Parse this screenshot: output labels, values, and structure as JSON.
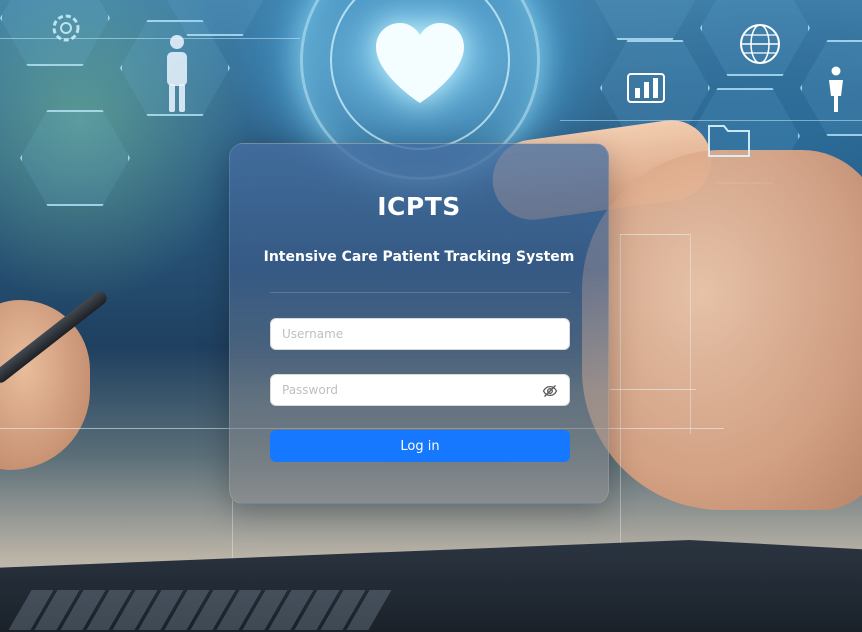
{
  "app": {
    "title": "ICPTS",
    "subtitle": "Intensive Care Patient Tracking System"
  },
  "form": {
    "username": {
      "placeholder": "Username",
      "value": ""
    },
    "password": {
      "placeholder": "Password",
      "value": ""
    },
    "login_label": "Log in"
  },
  "icons": {
    "password_toggle": "eye-slash-icon",
    "background": [
      "heart-icon",
      "person-icon",
      "globe-icon",
      "chart-icon",
      "folder-icon",
      "gear-icon"
    ]
  },
  "colors": {
    "primary": "#1677ff",
    "text_on_card": "#ffffff",
    "placeholder": "#bfbfbf"
  }
}
